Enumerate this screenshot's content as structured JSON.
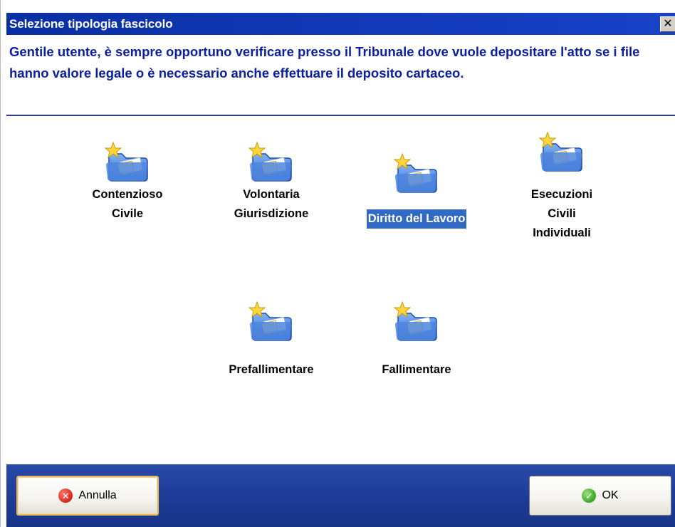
{
  "window": {
    "title": "Selezione tipologia fascicolo",
    "close_glyph": "✕"
  },
  "message": "Gentile utente, è sempre opportuno verificare presso il Tribunale dove vuole depositare l'atto se i file hanno valore legale o è necessario anche effettuare il deposito cartaceo.",
  "items": [
    {
      "label": "Contenzioso\nCivile",
      "icon": "folder-star-icon",
      "selected": false
    },
    {
      "label": "Volontaria\nGiurisdizione",
      "icon": "folder-star-icon",
      "selected": false
    },
    {
      "label": "Diritto del Lavoro",
      "icon": "folder-star-icon",
      "selected": true
    },
    {
      "label": "Esecuzioni\nCivili\nIndividuali",
      "icon": "folder-star-icon",
      "selected": false
    },
    {
      "label": "Prefallimentare",
      "icon": "folder-star-icon",
      "selected": false
    },
    {
      "label": "Fallimentare",
      "icon": "folder-star-icon",
      "selected": false
    }
  ],
  "buttons": {
    "cancel_label": "Annulla",
    "ok_label": "OK"
  },
  "colors": {
    "titlebar": "#0a2fa3",
    "message_text": "#0b1fa3",
    "selection": "#316ac5",
    "footer": "#1c3a95"
  }
}
